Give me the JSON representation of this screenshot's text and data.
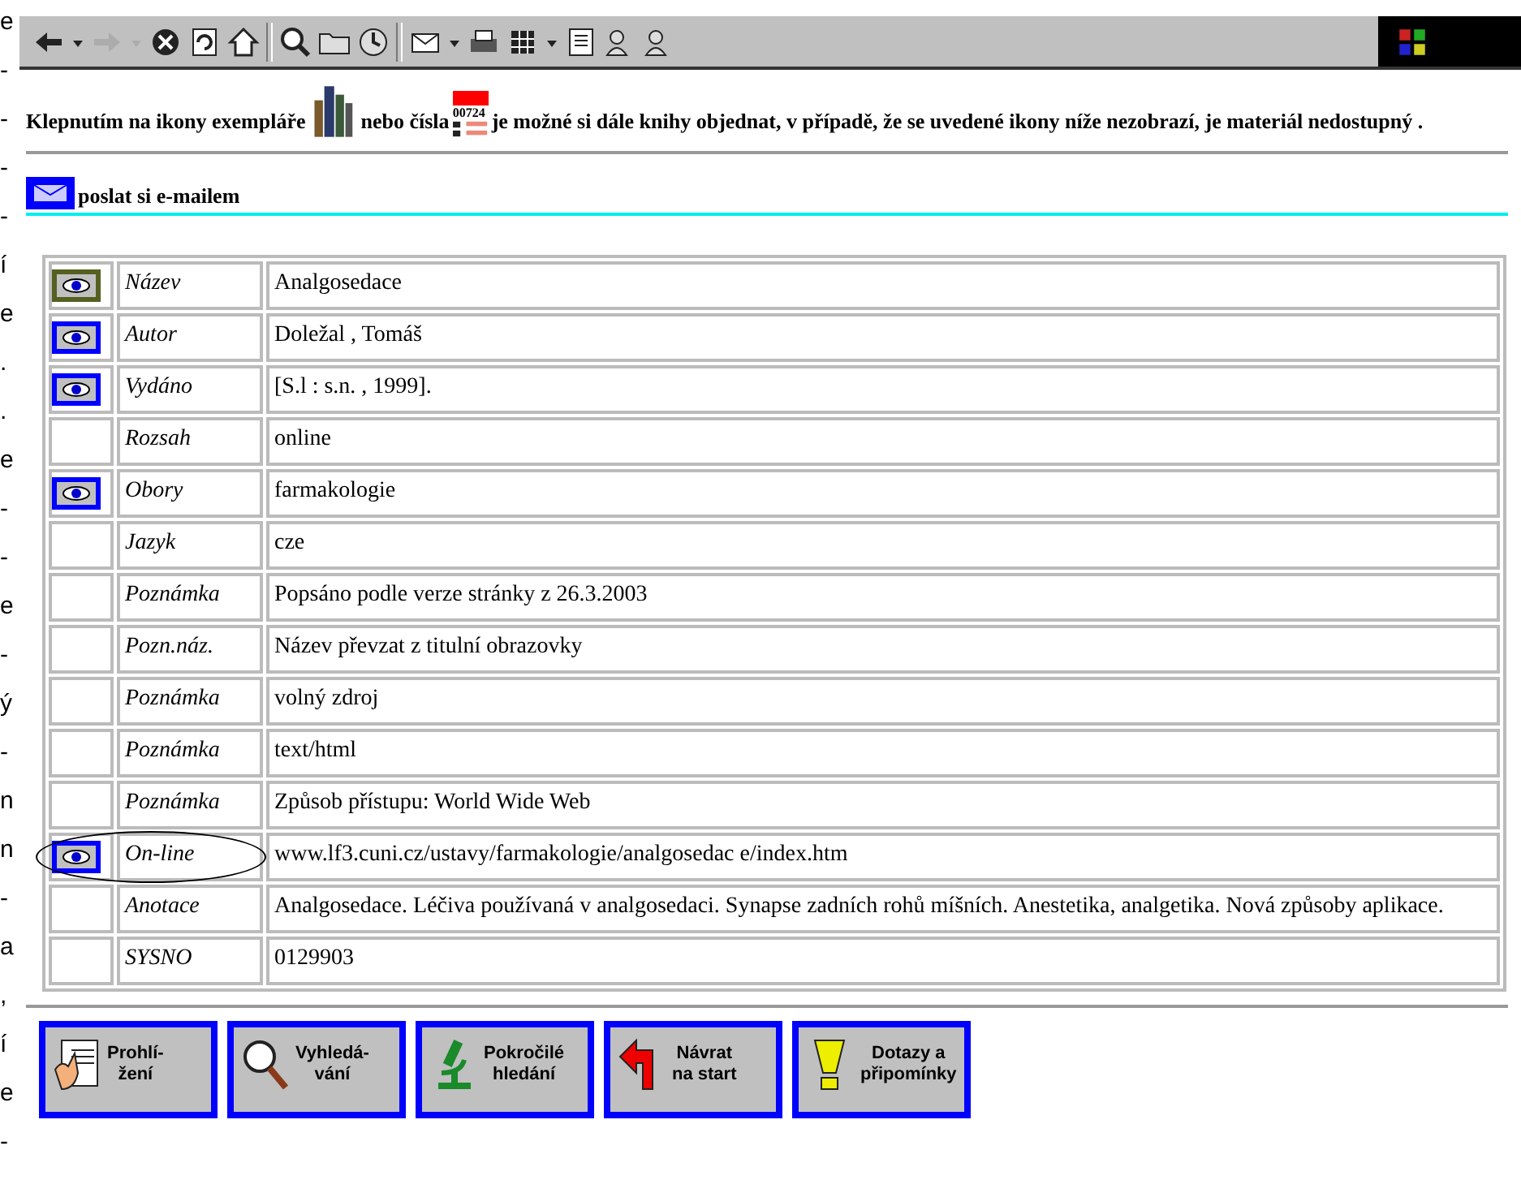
{
  "edge_fragments": [
    "e",
    "-",
    "-",
    "-",
    "-",
    "í",
    "e",
    ".",
    ".",
    "e",
    "-",
    "-",
    "e",
    "-",
    "ý",
    "-",
    "n",
    "n",
    "-",
    "a",
    ",",
    "í",
    "e",
    "-"
  ],
  "toolbar": [
    {
      "kind": "back",
      "disabled": false
    },
    {
      "kind": "drop",
      "disabled": false
    },
    {
      "kind": "forward",
      "disabled": true
    },
    {
      "kind": "drop",
      "disabled": true
    },
    {
      "kind": "stop",
      "disabled": false
    },
    {
      "kind": "refresh",
      "disabled": false
    },
    {
      "kind": "home",
      "disabled": false
    },
    {
      "kind": "sep"
    },
    {
      "kind": "search",
      "disabled": false
    },
    {
      "kind": "folder",
      "disabled": false
    },
    {
      "kind": "history",
      "disabled": false
    },
    {
      "kind": "sep"
    },
    {
      "kind": "mail",
      "disabled": false
    },
    {
      "kind": "drop",
      "disabled": false
    },
    {
      "kind": "print",
      "disabled": false
    },
    {
      "kind": "grid",
      "disabled": false
    },
    {
      "kind": "drop",
      "disabled": false
    },
    {
      "kind": "doc",
      "disabled": false
    },
    {
      "kind": "people",
      "disabled": false
    },
    {
      "kind": "people",
      "disabled": false
    }
  ],
  "intro": {
    "before": "Klepnutím na ikony exempláře",
    "middle": "nebo čísla",
    "badge": "00724",
    "after": "je možné si dále knihy objednat, v případě, že se uvedené ikony níže nezobrazí, je materiál nedostupný ."
  },
  "email_link": "poslat si e-mailem",
  "rows": [
    {
      "label": "Název",
      "value": "Analgosedace",
      "icon": true,
      "color": "#556020",
      "circled": false
    },
    {
      "label": "Autor",
      "value": "Doležal , Tomáš",
      "icon": true,
      "color": "#0000ff",
      "circled": false
    },
    {
      "label": "Vydáno",
      "value": "[S.l : s.n. , 1999].",
      "icon": true,
      "color": "#0000ff",
      "circled": false
    },
    {
      "label": "Rozsah",
      "value": "online",
      "icon": false,
      "circled": false
    },
    {
      "label": "Obory",
      "value": "farmakologie",
      "icon": true,
      "color": "#0000ff",
      "circled": false
    },
    {
      "label": "Jazyk",
      "value": "cze",
      "icon": false,
      "circled": false
    },
    {
      "label": "Poznámka",
      "value": "Popsáno podle verze stránky z 26.3.2003",
      "icon": false,
      "circled": false
    },
    {
      "label": "Pozn.náz.",
      "value": "Název převzat z titulní obrazovky",
      "icon": false,
      "circled": false
    },
    {
      "label": "Poznámka",
      "value": "volný zdroj",
      "icon": false,
      "circled": false
    },
    {
      "label": "Poznámka",
      "value": "text/html",
      "icon": false,
      "circled": false
    },
    {
      "label": "Poznámka",
      "value": "Způsob přístupu: World Wide Web",
      "icon": false,
      "circled": false
    },
    {
      "label": "On-line",
      "value": "www.lf3.cuni.cz/ustavy/farmakologie/analgosedac e/index.htm",
      "icon": true,
      "color": "#0000ff",
      "circled": true
    },
    {
      "label": "Anotace",
      "value": "Analgosedace. Léčiva používaná v analgosedaci. Synapse zadních rohů míšních. Anestetika, analgetika. Nová způsoby aplikace.",
      "icon": false,
      "circled": false
    },
    {
      "label": "SYSNO",
      "value": "0129903",
      "icon": false,
      "circled": false
    }
  ],
  "nav_buttons": [
    {
      "kind": "browse",
      "line1": "Prohlí-",
      "line2": "žení"
    },
    {
      "kind": "search",
      "line1": "Vyhledá-",
      "line2": "vání"
    },
    {
      "kind": "advanced",
      "line1": "Pokročilé",
      "line2": "hledání"
    },
    {
      "kind": "start",
      "line1": "Návrat",
      "line2": "na start"
    },
    {
      "kind": "questions",
      "line1": "Dotazy a",
      "line2": "připomínky"
    }
  ]
}
